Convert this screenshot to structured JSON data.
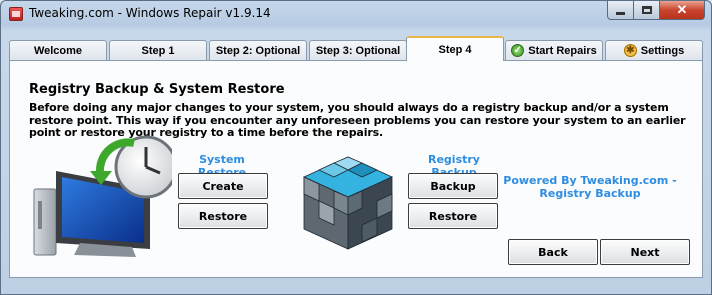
{
  "window": {
    "title": "Tweaking.com - Windows Repair v1.9.14",
    "close_glyph": "✕"
  },
  "tabs": [
    {
      "label": "Welcome",
      "active": false
    },
    {
      "label": "Step 1",
      "active": false
    },
    {
      "label": "Step 2: Optional",
      "active": false
    },
    {
      "label": "Step 3: Optional",
      "active": false
    },
    {
      "label": "Step 4",
      "active": true
    },
    {
      "label": "Start Repairs",
      "icon": "check-icon",
      "active": false
    },
    {
      "label": "Settings",
      "icon": "gear-icon",
      "active": false
    }
  ],
  "panel": {
    "title": "Registry Backup & System Restore",
    "description": "Before doing any major changes to your system, you should always do a registry backup and/or a system restore point. This way if you encounter any unforeseen problems you can restore your system to an earlier point or restore your registry to a time before the repairs."
  },
  "system_restore": {
    "label": "System Restore",
    "create_button": "Create",
    "restore_button": "Restore",
    "icon": "system-restore-computer-icon"
  },
  "registry_backup": {
    "label": "Registry Backup",
    "backup_button": "Backup",
    "restore_button": "Restore",
    "icon": "registry-cube-icon"
  },
  "powered_by": "Powered By Tweaking.com - Registry Backup",
  "nav": {
    "back_button": "Back",
    "next_button": "Next"
  },
  "colors": {
    "accent_blue": "#2e8de0",
    "active_tab_border": "#e8b64a",
    "close_button": "#c9452d"
  }
}
